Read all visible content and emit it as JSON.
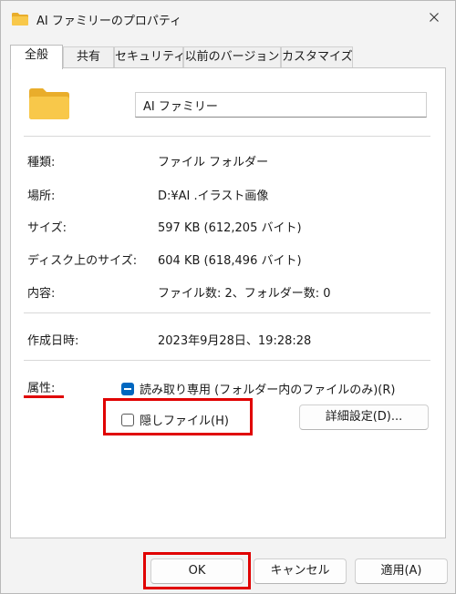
{
  "window": {
    "title": "AI ファミリーのプロパティ"
  },
  "tabs": [
    "全般",
    "共有",
    "セキュリティ",
    "以前のバージョン",
    "カスタマイズ"
  ],
  "name_field": {
    "value": "AI ファミリー"
  },
  "properties": {
    "type": {
      "label": "種類:",
      "value": "ファイル フォルダー"
    },
    "location": {
      "label": "場所:",
      "value": "D:¥AI .イラスト画像"
    },
    "size": {
      "label": "サイズ:",
      "value": "597 KB (612,205 バイト)"
    },
    "size_on_disk": {
      "label": "ディスク上のサイズ:",
      "value": "604 KB (618,496 バイト)"
    },
    "contents": {
      "label": "内容:",
      "value": "ファイル数: 2、フォルダー数: 0"
    },
    "created": {
      "label": "作成日時:",
      "value": "2023年9月28日、19:28:28"
    }
  },
  "attributes": {
    "label": "属性:",
    "readonly": {
      "label": "読み取り専用 (フォルダー内のファイルのみ)(R)",
      "state": "indeterminate"
    },
    "hidden": {
      "label": "隠しファイル(H)",
      "checked": false
    },
    "advanced_button": "詳細設定(D)..."
  },
  "buttons": {
    "ok": "OK",
    "cancel": "キャンセル",
    "apply": "適用(A)"
  },
  "colors": {
    "highlight": "#e00000",
    "accent": "#0067c0",
    "folder": "#f4c543"
  }
}
